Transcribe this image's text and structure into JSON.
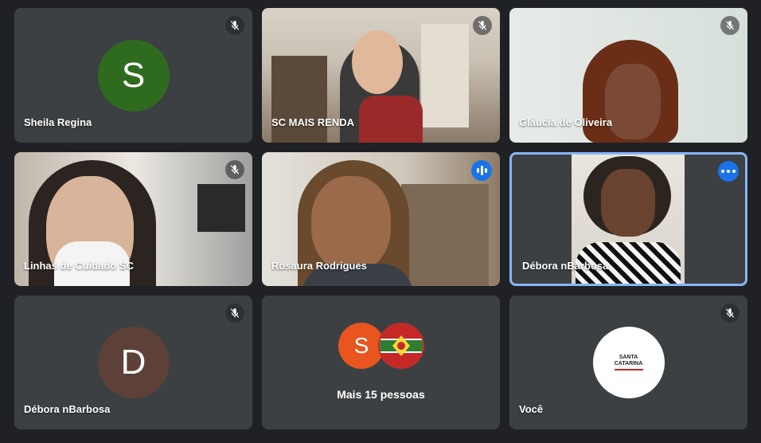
{
  "participants": [
    {
      "name": "Sheila Regina",
      "initial": "S",
      "avatar_color": "#2f6b1e",
      "muted": true
    },
    {
      "name": "SC MAIS RENDA",
      "muted": true
    },
    {
      "name": "Gláucia de Oliveira",
      "muted": true
    },
    {
      "name": "Linhas de Cuidado SC",
      "muted": true
    },
    {
      "name": "Rosaura Rodrigues",
      "speaking": true
    },
    {
      "name": "Débora nBarbosa",
      "active": true
    },
    {
      "name": "Débora nBarbosa",
      "initial": "D",
      "avatar_color": "#5d4037",
      "muted": true
    },
    {
      "more_label": "Mais 15 pessoas",
      "initial": "S",
      "avatar_color": "#e8551f"
    },
    {
      "name": "Você",
      "muted": true,
      "logo_lines": [
        "SANTA",
        "CATARINA"
      ]
    }
  ],
  "colors": {
    "background": "#202124",
    "tile": "#3c4043",
    "accent": "#8ab4f8",
    "speaking": "#1a73e8"
  },
  "icons": [
    "mic-off-icon",
    "speaking-indicator-icon",
    "more-options-icon"
  ]
}
